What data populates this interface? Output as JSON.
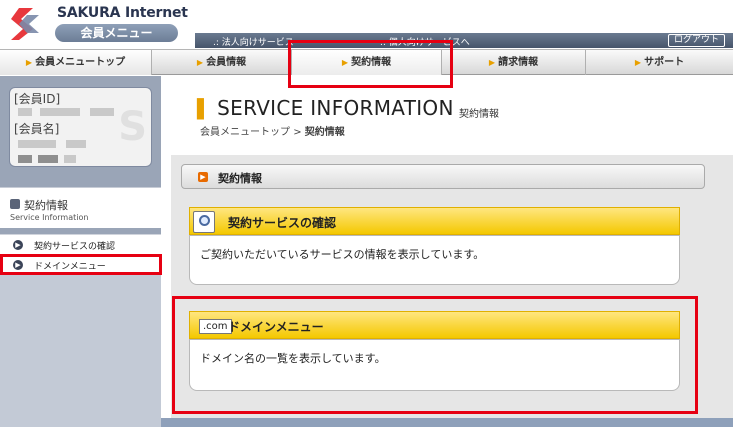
{
  "header": {
    "brand_name": "SAKURA Internet",
    "brand_badge": "会員メニュー",
    "top_links": [
      ".: 法人向けサービス",
      ".: 個人向けサービスへ"
    ],
    "logout_label": "ログアウト"
  },
  "tabs": [
    {
      "label": "会員メニュートップ"
    },
    {
      "label": "会員情報"
    },
    {
      "label": "契約情報"
    },
    {
      "label": "請求情報"
    },
    {
      "label": "サポート"
    }
  ],
  "sidebar": {
    "member_id_label": "[会員ID]",
    "member_name_label": "[会員名]",
    "section_title": "契約情報",
    "section_subtitle": "Service Information",
    "links": [
      {
        "label": "契約サービスの確認"
      },
      {
        "label": "ドメインメニュー"
      }
    ]
  },
  "main": {
    "title": "SERVICE INFORMATION",
    "subtitle": "契約情報",
    "breadcrumb_root": "会員メニュートップ",
    "breadcrumb_sep": ">",
    "breadcrumb_current": "契約情報",
    "section_label": "契約情報",
    "cards": [
      {
        "title": "契約サービスの確認",
        "description": "ご契約いただいているサービスの情報を表示しています。"
      },
      {
        "badge": ".com",
        "title": "ドメインメニュー",
        "description": "ドメイン名の一覧を表示しています。"
      }
    ]
  },
  "colors": {
    "accent_yellow": "#f4c800",
    "highlight_red": "#e60012",
    "sidebar_blue": "#9aa5b7",
    "brand_red": "#e8383d"
  }
}
